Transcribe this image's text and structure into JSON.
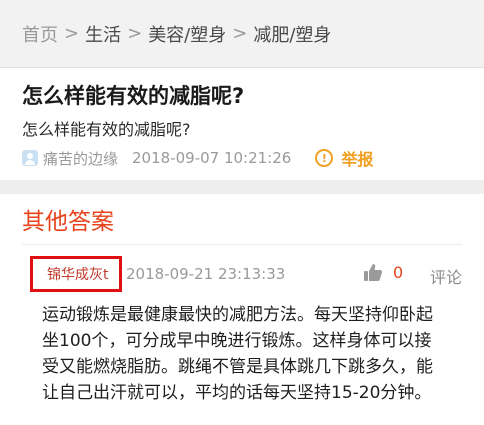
{
  "breadcrumb": {
    "items": [
      "首页",
      "生活",
      "美容/塑身",
      "减肥/塑身"
    ],
    "separator": ">"
  },
  "question": {
    "title": "怎么样能有效的减脂呢?",
    "body": "怎么样能有效的减脂呢?",
    "author": "痛苦的边缘",
    "time": "2018-09-07 10:21:26",
    "report_label": "举报"
  },
  "answers": {
    "heading": "其他答案",
    "items": [
      {
        "author": "锦华成灰t",
        "time": "2018-09-21 23:13:33",
        "likes": "0",
        "comment_label": "评论",
        "lines": [
          "运动锻炼是最健康最快的减肥方法。每天坚持仰卧起",
          "坐100个，可分成早中晚进行锻炼。这样身体可以接",
          "受又能燃烧脂肪。跳绳不管是具体跳几下跳多久，能",
          "让自己出汗就可以，平均的话每天坚持15-20分钟。"
        ]
      }
    ]
  },
  "colors": {
    "accent_red": "#e8431c",
    "highlight_box": "#e01010",
    "report_orange": "#f0a020",
    "muted_gray": "#9a9a9a"
  },
  "icons": {
    "user": "user-icon",
    "report": "warning-circle-icon",
    "like": "thumbs-up-icon"
  }
}
